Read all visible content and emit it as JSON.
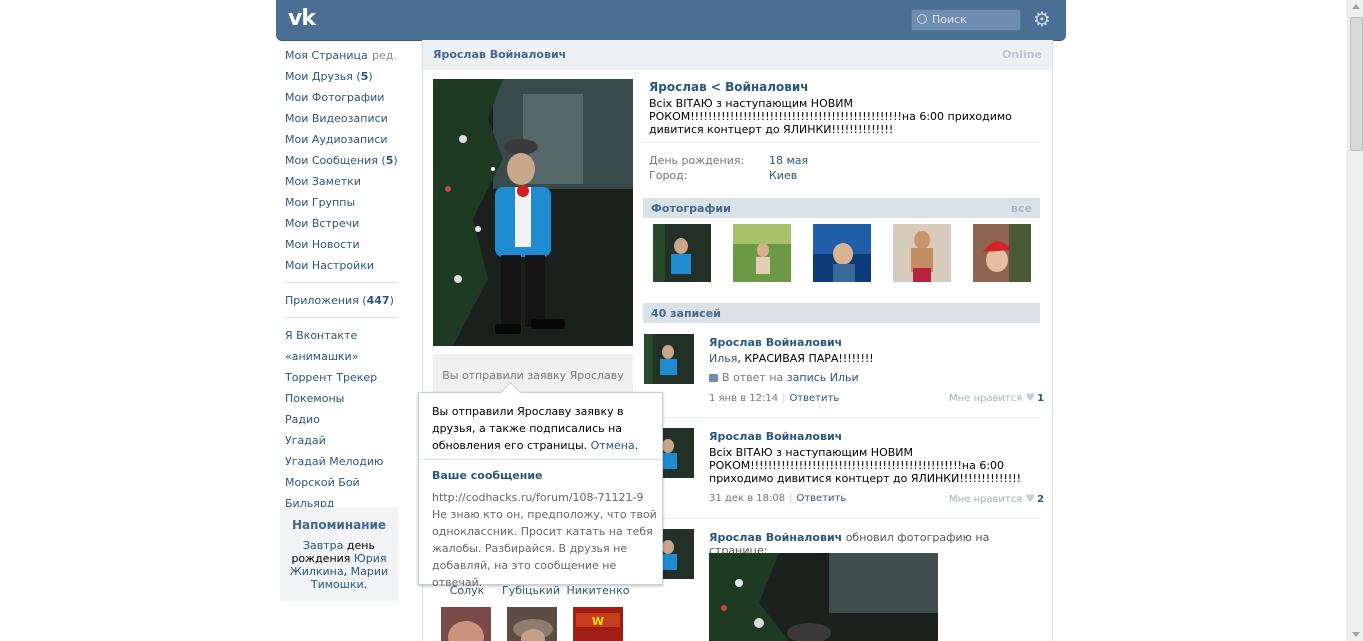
{
  "header": {
    "logo": "vk",
    "search_placeholder": "Поиск",
    "settings_icon": "gear-icon"
  },
  "sidebar": {
    "edit": "ред.",
    "items": [
      {
        "label": "Моя Страница"
      },
      {
        "label": "Мои Друзья",
        "count": "5"
      },
      {
        "label": "Мои Фотографии"
      },
      {
        "label": "Мои Видеозаписи"
      },
      {
        "label": "Мои Аудиозаписи"
      },
      {
        "label": "Мои Сообщения",
        "count": "5"
      },
      {
        "label": "Мои Заметки"
      },
      {
        "label": "Мои Группы"
      },
      {
        "label": "Мои Встречи"
      },
      {
        "label": "Мои Новости"
      },
      {
        "label": "Мои Настройки"
      }
    ],
    "apps": {
      "label": "Приложения",
      "count": "447"
    },
    "app_items": [
      "Я Вконтакте",
      "«анимашки»",
      "Торрент Трекер",
      "Покемоны",
      "Радио",
      "Угадай",
      "Угадай Мелодию",
      "Морской Бой",
      "Бильярд"
    ],
    "reminder": {
      "title": "Напоминание",
      "w1": "Завтра",
      "w2": "день рождения",
      "w3": "Юрия Жилкина",
      "w4": ", ",
      "w5": "Марии Тимошки",
      "w6": "."
    }
  },
  "profile": {
    "header_name": "Ярослав Войналович",
    "online": "Online",
    "request_button": "Вы отправили заявку Ярославу",
    "name": "Ярослав < Войналович",
    "status": "Всіх ВІТАЮ з наступающим НОВИМ РОКОМ!!!!!!!!!!!!!!!!!!!!!!!!!!!!!!!!!!!!!!!!!!!!!!!!на 6:00 приходимо дивитися контцерт до ЯЛИНКИ!!!!!!!!!!!!!!",
    "birthday_label": "День рождения:",
    "birthday": "18 мая",
    "city_label": "Город:",
    "city": "Киев"
  },
  "friends": [
    "Солук",
    "Губіцький",
    "Никитенко"
  ],
  "photos": {
    "title": "Фотографии",
    "all": "все"
  },
  "wall": {
    "title": "40 записей",
    "posts": [
      {
        "author": "Ярослав Войналович",
        "to": "Илья",
        "text": ", КРАСИВАЯ ПАРА!!!!!!!!",
        "reply_prefix": "В ответ на",
        "reply_link": "запись Ильи",
        "date": "1 янв в 12:14",
        "reply": "Ответить",
        "like": "Мне нравится",
        "likes": "1"
      },
      {
        "author": "Ярослав Войналович",
        "text": "Всіх ВІТАЮ з наступающим НОВИМ РОКОМ!!!!!!!!!!!!!!!!!!!!!!!!!!!!!!!!!!!!!!!!!!!!!!!!на 6:00 приходимо дивитися контцерт до ЯЛИНКИ!!!!!!!!!!!!!!",
        "date": "31 дек в 18:08",
        "reply": "Ответить",
        "like": "Мне нравится",
        "likes": "2"
      },
      {
        "author": "Ярослав Войналович",
        "action": "обновил фотографию на странице:"
      }
    ]
  },
  "popup": {
    "text": "Вы отправили Ярославу заявку в друзья, а также подписались на обновления его страницы.",
    "cancel": "Отмена",
    "dot": ".",
    "msg_title": "Ваше сообщение",
    "msg_body": "http://codhacks.ru/forum/108-71121-9 Не знаю кто он, предположу, что твой одноклассник. Просит катать на тебя жалобы. Разбирайся. В друзья не добавляй, на это сообщение не отвечай."
  }
}
